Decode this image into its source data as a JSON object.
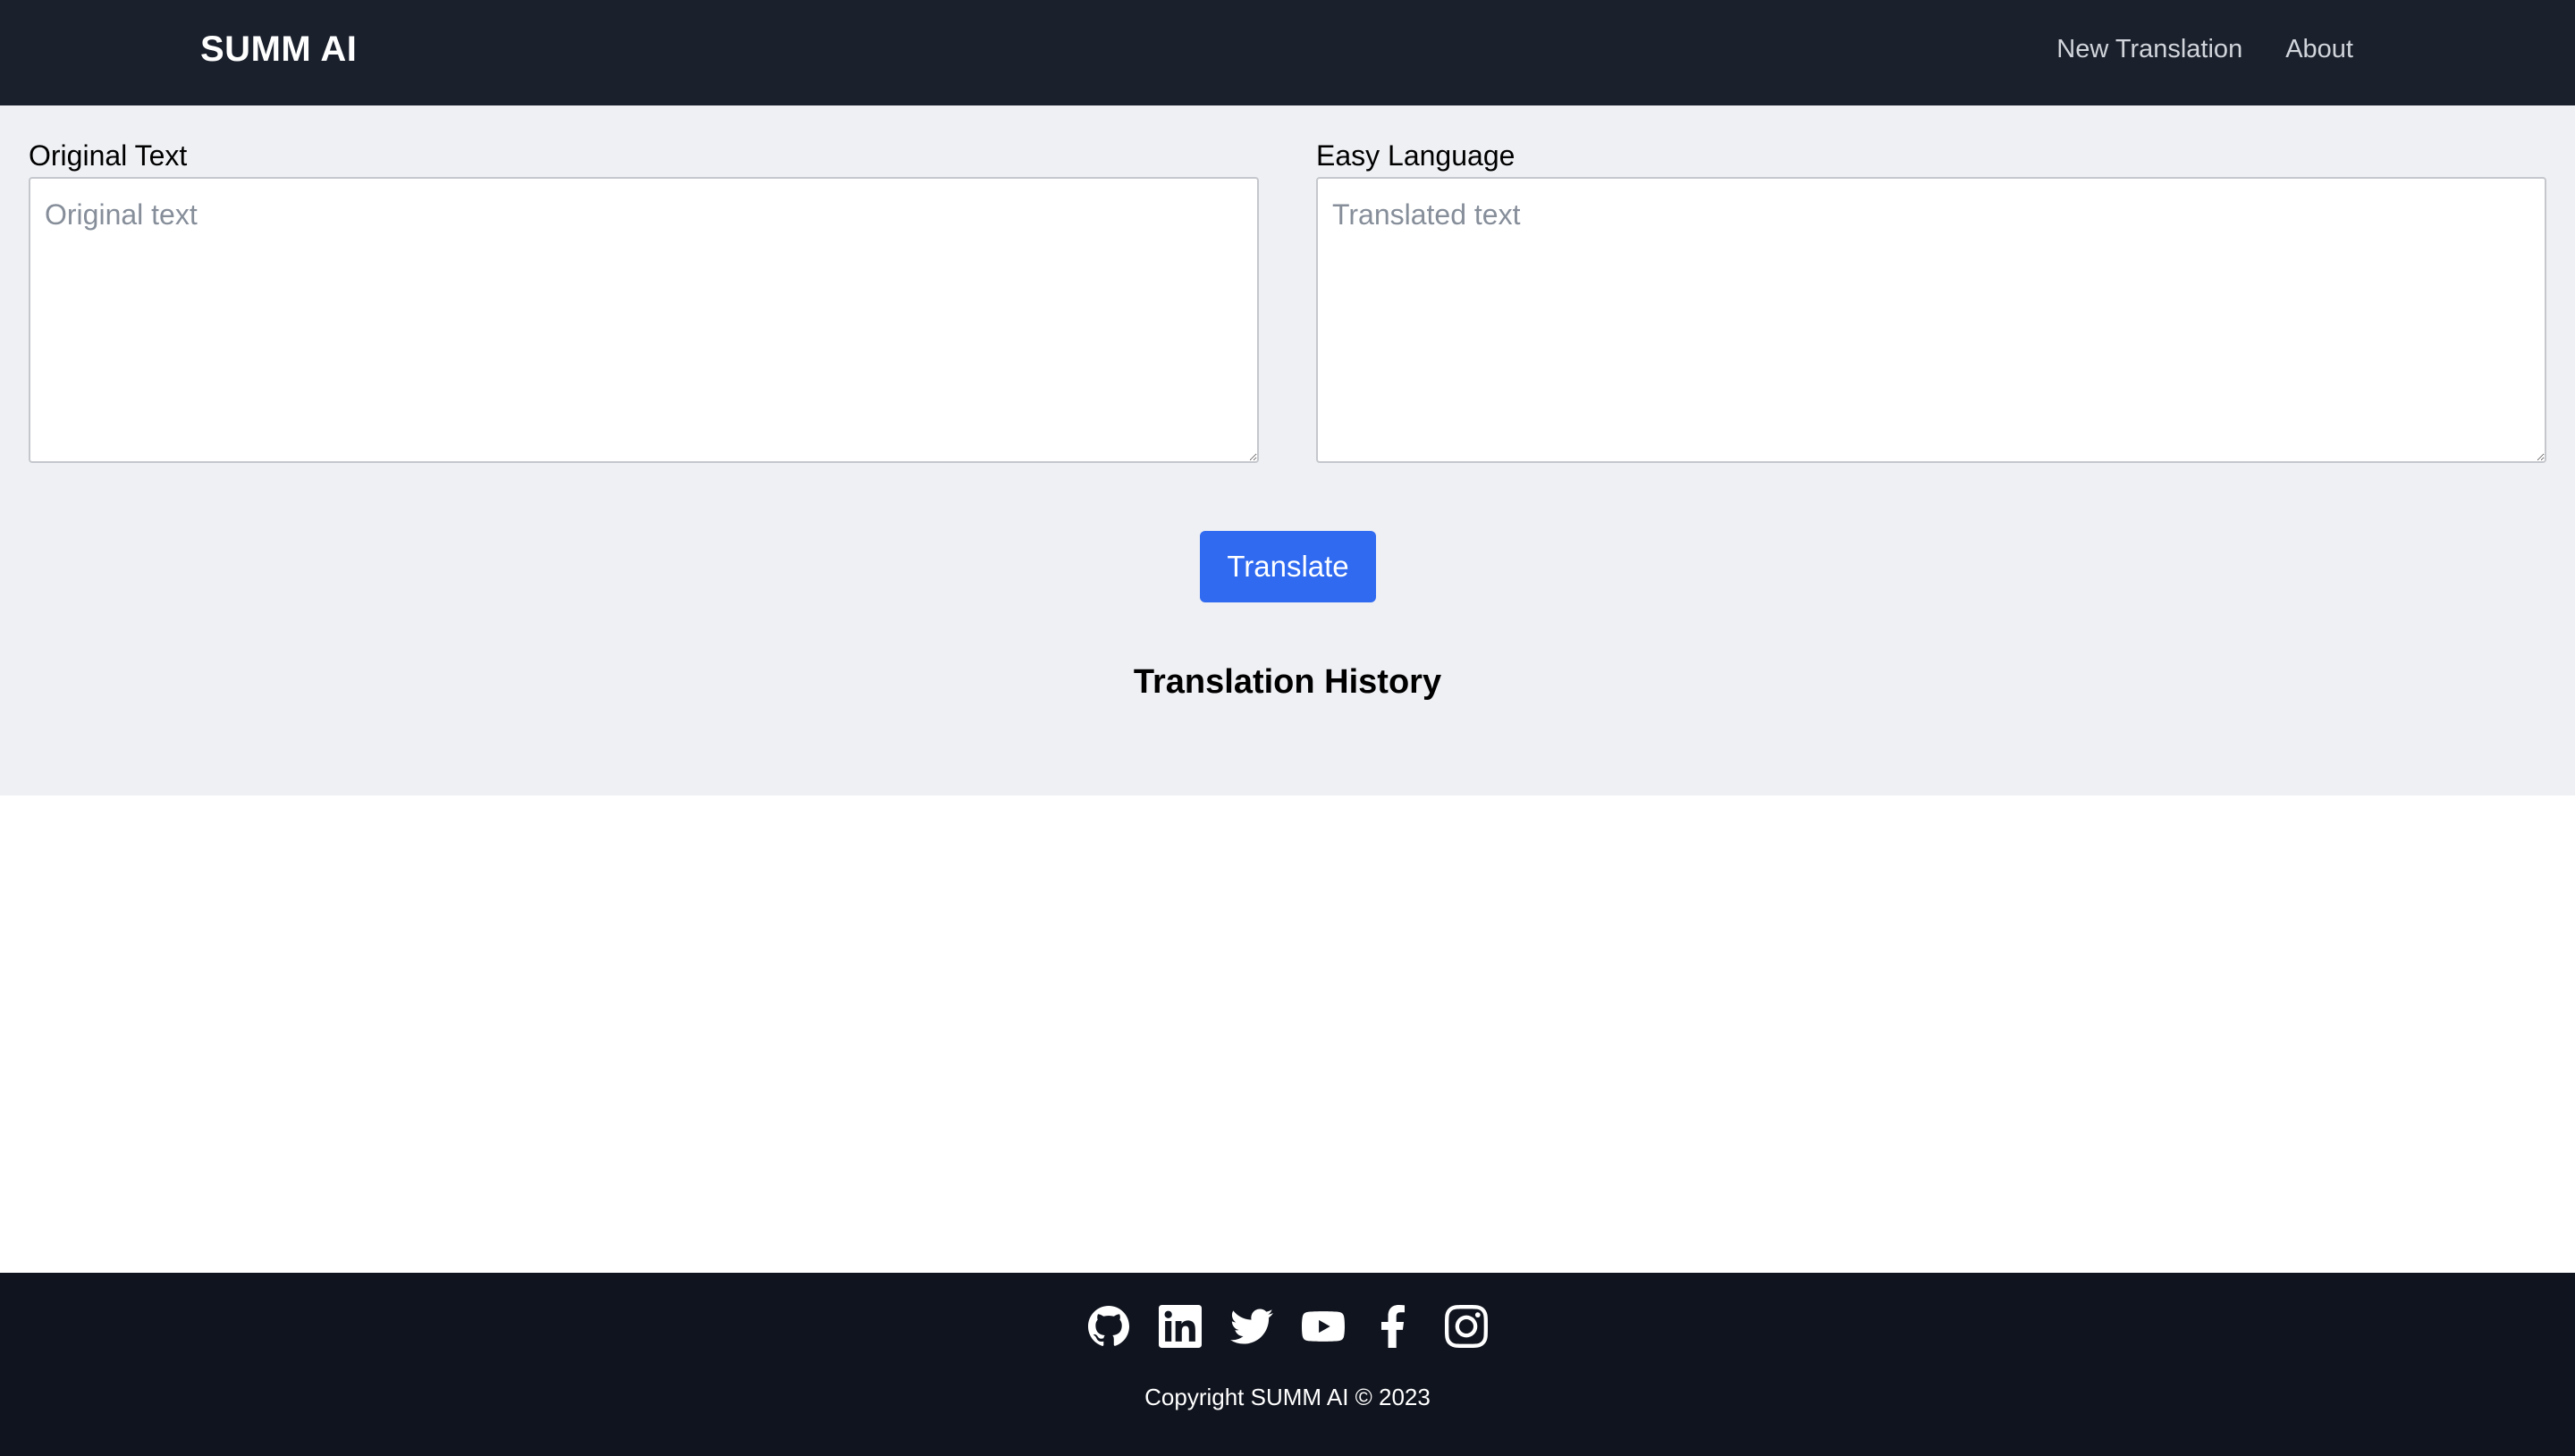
{
  "navbar": {
    "brand": "SUMM AI",
    "links": [
      {
        "label": "New Translation"
      },
      {
        "label": "About"
      }
    ]
  },
  "form": {
    "original": {
      "label": "Original Text",
      "placeholder": "Original text",
      "value": ""
    },
    "easy": {
      "label": "Easy Language",
      "placeholder": "Translated text",
      "value": ""
    },
    "translate_label": "Translate"
  },
  "history": {
    "title": "Translation History"
  },
  "footer": {
    "social_icons": [
      "github-icon",
      "linkedin-icon",
      "twitter-icon",
      "youtube-icon",
      "facebook-icon",
      "instagram-icon"
    ],
    "copyright": "Copyright SUMM AI © 2023"
  },
  "colors": {
    "navbar_bg": "#1a202c",
    "main_bg": "#eff0f4",
    "button_bg": "#2f6af0",
    "footer_bg": "#10141e"
  }
}
